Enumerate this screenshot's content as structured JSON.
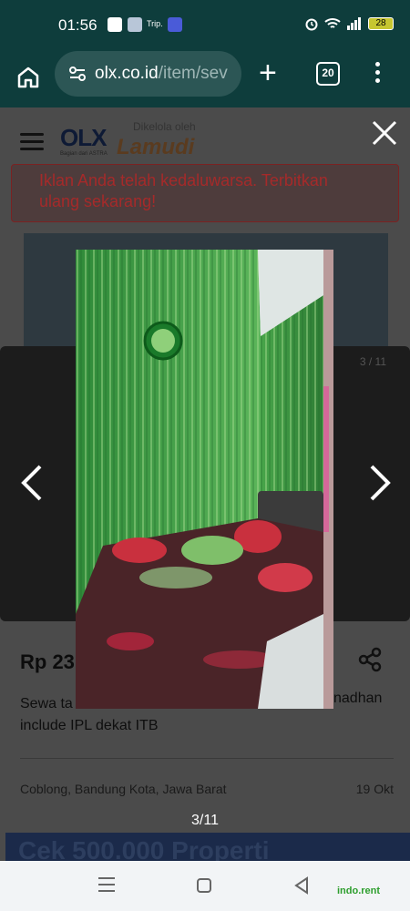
{
  "status_bar": {
    "time": "01:56",
    "notification_label": "Trip.",
    "battery": "28"
  },
  "browser": {
    "url_host": "olx.co.id",
    "url_path": "/item/sev",
    "tab_count": "20"
  },
  "header": {
    "logo": "OLX",
    "logo_sub": "Bagian dari ASTRA",
    "managed_by": "Dikelola oleh",
    "partner_logo": "Lamudi"
  },
  "alert": {
    "text": "Iklan Anda telah kedaluwarsa. Terbitkan ulang sekarang!"
  },
  "carousel": {
    "counter_small": "3 / 11"
  },
  "listing": {
    "price": "Rp 23",
    "desc_left": "Sewa ta",
    "desc_right": "nadhan",
    "desc_line2": "include IPL dekat ITB",
    "location": "Coblong, Bandung Kota, Jawa Barat",
    "date": "19 Okt"
  },
  "bottom_ad": {
    "text": "Cek 500.000 Properti"
  },
  "viewer": {
    "counter": "3/11"
  },
  "system_nav": {
    "watermark": "indo.rent"
  },
  "colors": {
    "status_bg": "#0e3d3c",
    "alert_text": "#a52a2a",
    "wallpaper_green": "#4aa24a"
  }
}
